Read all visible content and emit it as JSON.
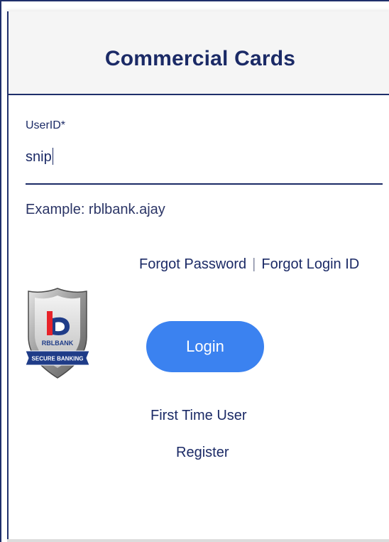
{
  "header": {
    "title": "Commercial Cards"
  },
  "login_form": {
    "userid_label": "UserID*",
    "userid_value": "snip",
    "example_text": "Example: rblbank.ajay",
    "forgot_password": "Forgot Password",
    "separator": "|",
    "forgot_login_id": "Forgot Login ID",
    "login_button": "Login",
    "first_time_user": "First Time User",
    "register": "Register"
  },
  "badge": {
    "brand_text": "RBLBANK",
    "ribbon_text": "SECURE BANKING",
    "icon": "shield-icon"
  },
  "colors": {
    "primary_navy": "#1b2a66",
    "button_blue": "#3b82f0",
    "header_bg": "#f5f5f5",
    "rbl_red": "#e8232a"
  }
}
